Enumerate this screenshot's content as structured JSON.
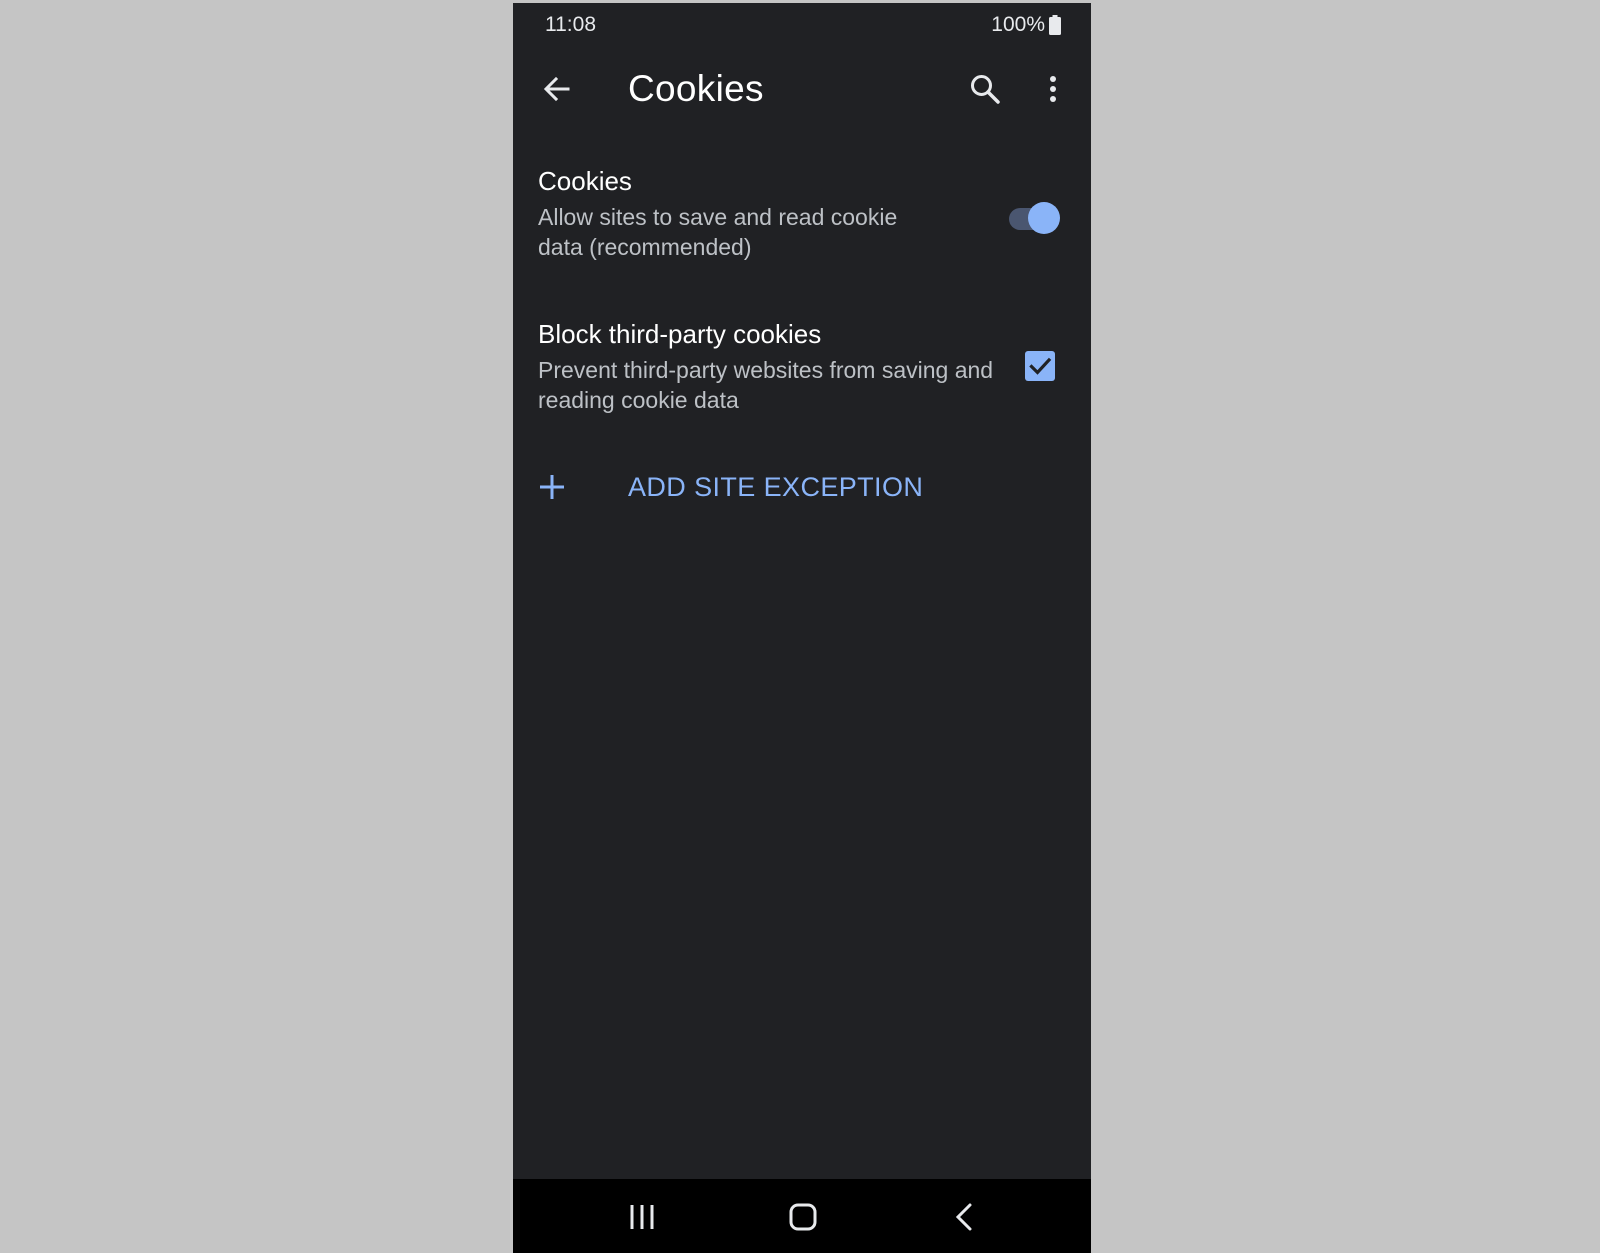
{
  "status_bar": {
    "time": "11:08",
    "battery": "100%",
    "icons": [
      "battery-icon"
    ]
  },
  "toolbar": {
    "title": "Cookies",
    "icons": [
      "back-arrow-icon",
      "search-icon",
      "more-vert-icon"
    ]
  },
  "settings": {
    "cookies": {
      "title": "Cookies",
      "summary": "Allow sites to save and read cookie data (recommended)",
      "enabled": true
    },
    "block_third_party": {
      "title": "Block third-party cookies",
      "summary": "Prevent third-party websites from saving and reading cookie data",
      "checked": true
    }
  },
  "add_exception": {
    "label": "ADD SITE EXCEPTION",
    "icon": "plus-icon"
  },
  "nav_bar": {
    "icons": [
      "recents-icon",
      "home-icon",
      "back-icon"
    ]
  },
  "colors": {
    "background": "#202124",
    "accent": "#8ab4f8",
    "outer_background": "#c5c5c5",
    "nav_background": "#000000"
  }
}
